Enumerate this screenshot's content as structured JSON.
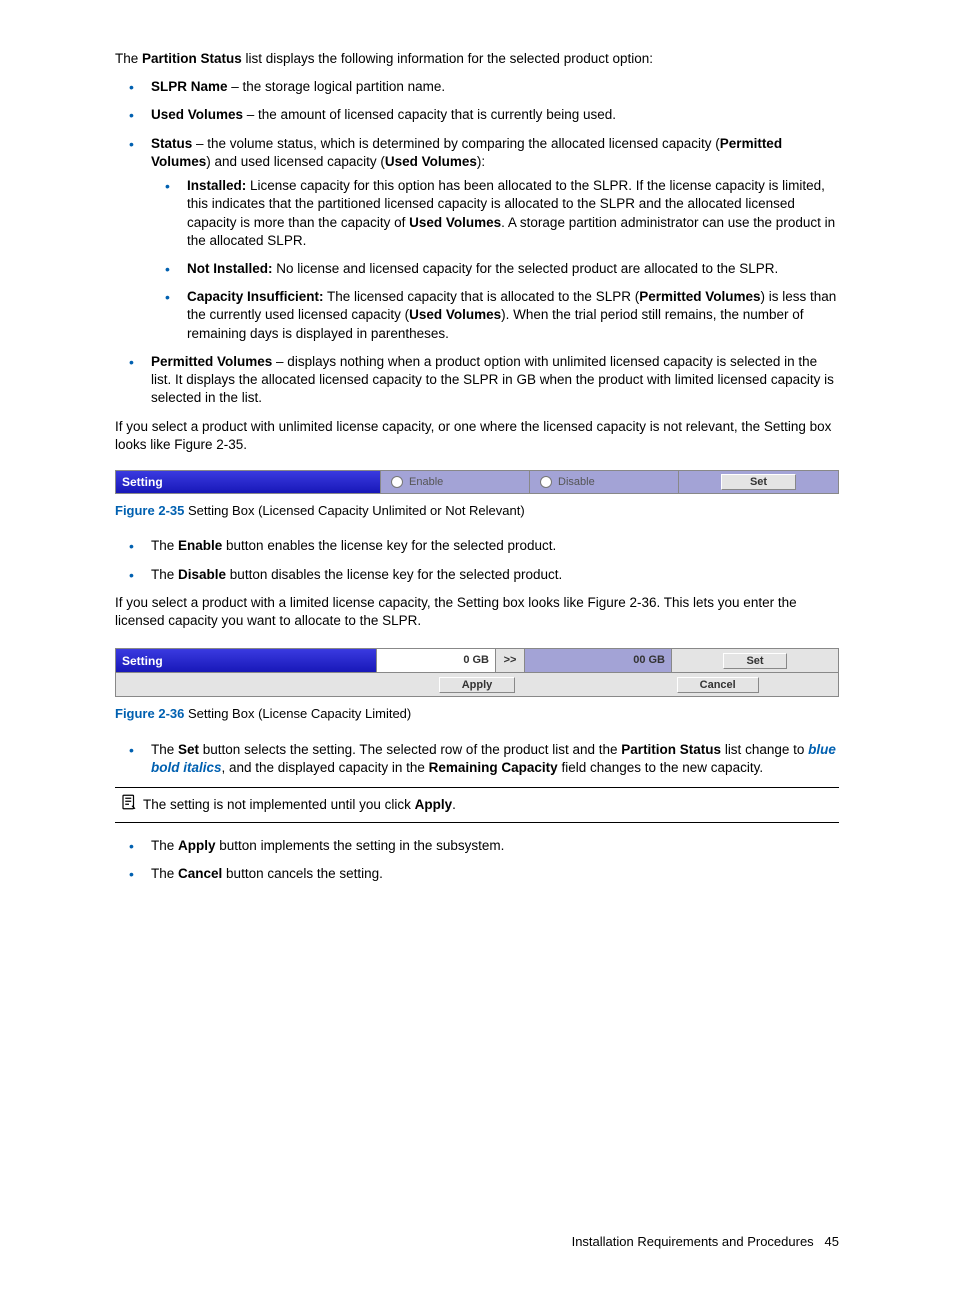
{
  "intro": {
    "pre": "The ",
    "bold": "Partition Status",
    "post": " list displays the following information for the selected product option:"
  },
  "bullets_main": {
    "slpr": {
      "term": "SLPR Name",
      "desc": " – the storage logical partition name."
    },
    "used": {
      "term": "Used Volumes",
      "desc": " – the amount of licensed capacity that is currently being used."
    },
    "status": {
      "term": "Status",
      "desc_pre": " – the volume status, which is determined by comparing the allocated licensed capacity (",
      "desc_b1": "Permitted Volumes",
      "desc_mid": ") and used licensed capacity (",
      "desc_b2": "Used Volumes",
      "desc_post": "):",
      "sub": {
        "installed": {
          "term": "Installed:",
          "t1": " License capacity for this option has been allocated to the SLPR. If the license capacity is limited, this indicates that the partitioned licensed capacity is allocated to the SLPR and the allocated licensed capacity is more than the capacity of ",
          "b1": "Used Volumes",
          "t2": ". A storage partition administrator can use the product in the allocated SLPR."
        },
        "notinstalled": {
          "term": "Not Installed:",
          "t1": " No license and licensed capacity for the selected product are allocated to the SLPR."
        },
        "capins": {
          "term": "Capacity Insufficient:",
          "t1": " The licensed capacity that is allocated to the SLPR (",
          "b1": "Permitted Volumes",
          "t2": ") is less than the currently used licensed capacity (",
          "b2": "Used Volumes",
          "t3": "). When the trial period still remains, the number of remaining days is displayed in parentheses."
        }
      }
    },
    "perm": {
      "term": "Permitted Volumes",
      "desc": " – displays nothing when a product option with unlimited licensed capacity is selected in the list. It displays the allocated licensed capacity to the SLPR in GB when the product with limited licensed capacity is selected in the list."
    }
  },
  "para_unlimited": "If you select a product with unlimited license capacity, or one where the licensed capacity is not relevant, the Setting box looks like Figure 2-35.",
  "fig35": {
    "num": "Figure 2-35",
    "caption": " Setting Box (Licensed Capacity Unlimited or Not Relevant)",
    "label": "Setting",
    "enable": "Enable",
    "disable": "Disable",
    "set": "Set"
  },
  "bullets_enable": {
    "en": {
      "pre": "The ",
      "b": "Enable",
      "post": " button enables the license key for the selected product."
    },
    "di": {
      "pre": "The ",
      "b": "Disable",
      "post": " button disables the license key for the selected product."
    }
  },
  "para_limited": "If you select a product with a limited license capacity, the Setting box looks like Figure 2-36. This lets you enter the licensed capacity you want to allocate to the SLPR.",
  "fig36": {
    "num": "Figure 2-36",
    "caption": " Setting Box (License Capacity Limited)",
    "label": "Setting",
    "input": "0 GB",
    "arrow": ">>",
    "display": "00 GB",
    "set": "Set",
    "apply": "Apply",
    "cancel": "Cancel"
  },
  "bullets_set": {
    "set": {
      "pre": "The ",
      "b1": "Set",
      "t1": " button selects the setting. The selected row of the product list and the ",
      "b2": "Partition Status",
      "t2": " list change to ",
      "bi": "blue bold italics",
      "t3": ", and the displayed capacity in the ",
      "b3": "Remaining Capacity",
      "t4": " field changes to the new capacity."
    }
  },
  "note": {
    "pre": "The setting is not implemented until you click ",
    "b": "Apply",
    "post": "."
  },
  "bullets_apply": {
    "ap": {
      "pre": "The ",
      "b": "Apply",
      "post": " button implements the setting in the subsystem."
    },
    "ca": {
      "pre": "The ",
      "b": "Cancel",
      "post": " button cancels the setting."
    }
  },
  "footer": {
    "text": "Installation Requirements and Procedures",
    "page": "45"
  }
}
